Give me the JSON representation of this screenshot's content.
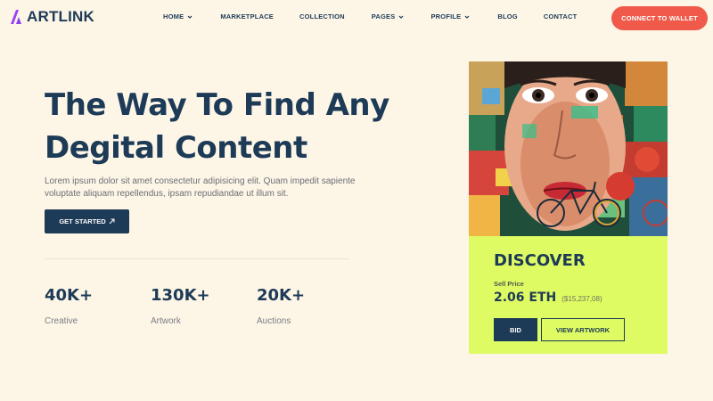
{
  "brand": {
    "name": "ARTLINK",
    "accent": "#a83df0"
  },
  "nav": {
    "items": [
      {
        "label": "HOME",
        "dropdown": true
      },
      {
        "label": "MARKETPLACE",
        "dropdown": false
      },
      {
        "label": "COLLECTION",
        "dropdown": false
      },
      {
        "label": "PAGES",
        "dropdown": true
      },
      {
        "label": "PROFILE",
        "dropdown": true
      },
      {
        "label": "BLOG",
        "dropdown": false
      },
      {
        "label": "CONTACT",
        "dropdown": false
      }
    ],
    "connect_label": "CONNECT TO WALLET"
  },
  "hero": {
    "title_line1": "The Way To Find Any",
    "title_line2": "Degital Content",
    "description": "Lorem ipsum dolor sit amet consectetur adipisicing elit. Quam impedit sapiente voluptate aliquam repellendus, ipsam repudiandae ut illum sit.",
    "cta_label": "GET STARTED",
    "cta_icon": "arrow-up-right-icon"
  },
  "stats": [
    {
      "value": "40K+",
      "label": "Creative"
    },
    {
      "value": "130K+",
      "label": "Artwork"
    },
    {
      "value": "20K+",
      "label": "Auctions"
    }
  ],
  "card": {
    "title": "DISCOVER",
    "sell_label": "Sell Price",
    "price_eth": "2.06 ETH",
    "price_usd": "($15,237,08)",
    "bid_label": "BID",
    "view_label": "VIEW ARTWORK",
    "background": "#dffb63"
  },
  "colors": {
    "primary": "#1d3a57",
    "connect": "#ef5a4a",
    "background": "#fdf6e7"
  }
}
